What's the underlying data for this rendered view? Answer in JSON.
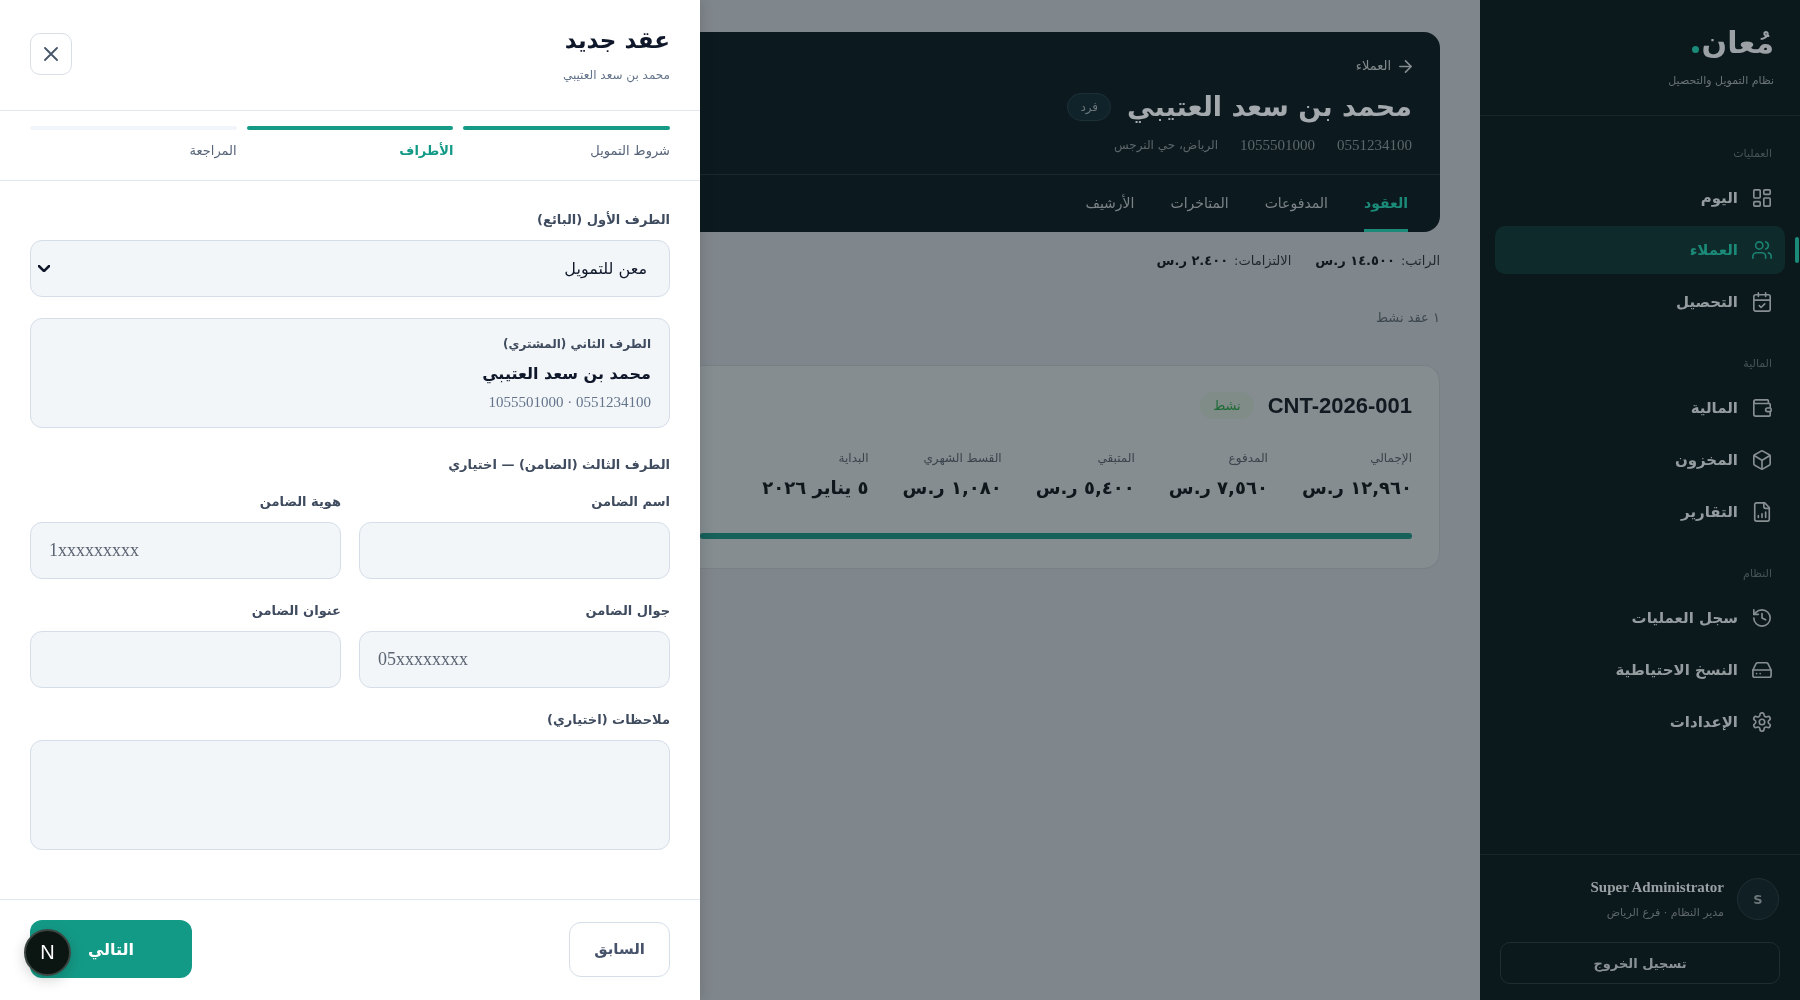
{
  "drawer": {
    "title": "عقد جديد",
    "subtitle": "محمد بن سعد العتيبي",
    "steps": [
      {
        "label": "شروط التمويل",
        "reached": true,
        "selected": false
      },
      {
        "label": "الأطراف",
        "reached": true,
        "selected": true
      },
      {
        "label": "المراجعة",
        "reached": false,
        "selected": false
      }
    ],
    "seller": {
      "label": "الطرف الأول (البائع)",
      "value": "معن للتمويل"
    },
    "buyer": {
      "label": "الطرف الثاني (المشتري)",
      "name": "محمد بن سعد العتيبي",
      "ids": "1055501000 · 0551234100"
    },
    "guarantor": {
      "heading": "الطرف الثالث (الضامن) — اختياري",
      "fields": [
        {
          "label": "اسم الضامن"
        },
        {
          "label": "هوية الضامن",
          "placeholder": "1xxxxxxxxx"
        },
        {
          "label": "جوال الضامن",
          "placeholder": "05xxxxxxxx"
        },
        {
          "label": "عنوان الضامن"
        }
      ]
    },
    "notes": {
      "label": "ملاحظات (اختياري)"
    },
    "buttons": {
      "previous": "السابق",
      "next": "التالي"
    }
  },
  "dev_badge": {
    "label": "N"
  },
  "client": {
    "breadcrumb": "العملاء",
    "name": "محمد بن سعد العتيبي",
    "type_badge": "فرد",
    "meta": [
      "0551234100",
      "1055501000",
      "الرياض، حي النرجس"
    ],
    "tabs": [
      {
        "label": "العقود",
        "selected": true
      },
      {
        "label": "المدفوعات",
        "selected": false
      },
      {
        "label": "المتاخرات",
        "selected": false
      },
      {
        "label": "الأرشيف",
        "selected": false
      }
    ]
  },
  "summary": [
    {
      "label": "الراتب:",
      "value": "١٤.٥٠٠ ر.س"
    },
    {
      "label": "الالتزامات:",
      "value": "٢.٤٠٠ ر.س"
    }
  ],
  "contracts_count": "١ عقد نشط",
  "contract": {
    "number": "CNT-2026-001",
    "status": "نشط",
    "stats": [
      {
        "label": "الإجمالي",
        "value": "١٢,٩٦٠ ر.س"
      },
      {
        "label": "المدفوع",
        "value": "٧,٥٦٠ ر.س"
      },
      {
        "label": "المتبقي",
        "value": "٥,٤٠٠ ر.س"
      },
      {
        "label": "القسط الشهري",
        "value": "١,٠٨٠ ر.س"
      },
      {
        "label": "البداية",
        "value": "٥ يناير ٢٠٢٦"
      }
    ],
    "level": 1
  },
  "sidebar": {
    "logo": "مُعان",
    "tagline": "نظام التمويل والتحصيل",
    "sections": [
      {
        "title": "العمليات",
        "items": [
          {
            "label": "اليوم",
            "selected": false
          },
          {
            "label": "العملاء",
            "selected": true
          },
          {
            "label": "التحصيل",
            "selected": false
          }
        ]
      },
      {
        "title": "المالية",
        "items": [
          {
            "label": "المالية",
            "selected": false
          },
          {
            "label": "المخزون",
            "selected": false
          },
          {
            "label": "التقارير",
            "selected": false
          }
        ]
      },
      {
        "title": "النظام",
        "items": [
          {
            "label": "سجل العمليات",
            "selected": false
          },
          {
            "label": "النسخ الاحتياطية",
            "selected": false
          },
          {
            "label": "الإعدادات",
            "selected": false
          }
        ]
      }
    ],
    "user": {
      "initial": "S",
      "name": "Super Administrator",
      "role": "مدير النظام · فرع الرياض"
    },
    "logout": "تسجيل الخروج"
  }
}
